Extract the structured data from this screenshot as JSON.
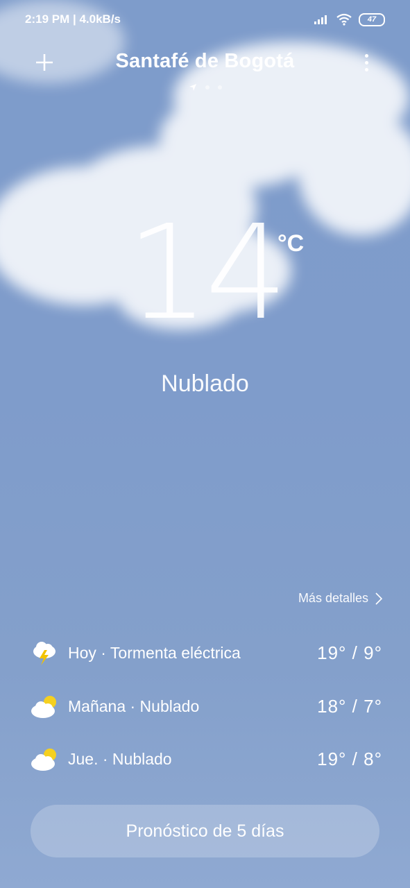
{
  "status_bar": {
    "time": "2:19 PM | 4.0kB/s",
    "battery": "47"
  },
  "header": {
    "city": "Santafé de Bogotá"
  },
  "current": {
    "temperature": "14",
    "unit": "°C",
    "condition": "Nublado"
  },
  "details_link": "Más detalles",
  "forecast": [
    {
      "label": "Hoy · Tormenta eléctrica",
      "temps": "19° / 9°",
      "icon": "thunderstorm-icon"
    },
    {
      "label": "Mañana · Nublado",
      "temps": "18° / 7°",
      "icon": "partly-cloudy-icon"
    },
    {
      "label": "Jue. · Nublado",
      "temps": "19° / 8°",
      "icon": "partly-cloudy-icon"
    }
  ],
  "cta": {
    "label": "Pronóstico de 5 días"
  },
  "colors": {
    "sky": "#7e9ccb",
    "sun": "#f5d020",
    "lightning": "#f2c300"
  }
}
